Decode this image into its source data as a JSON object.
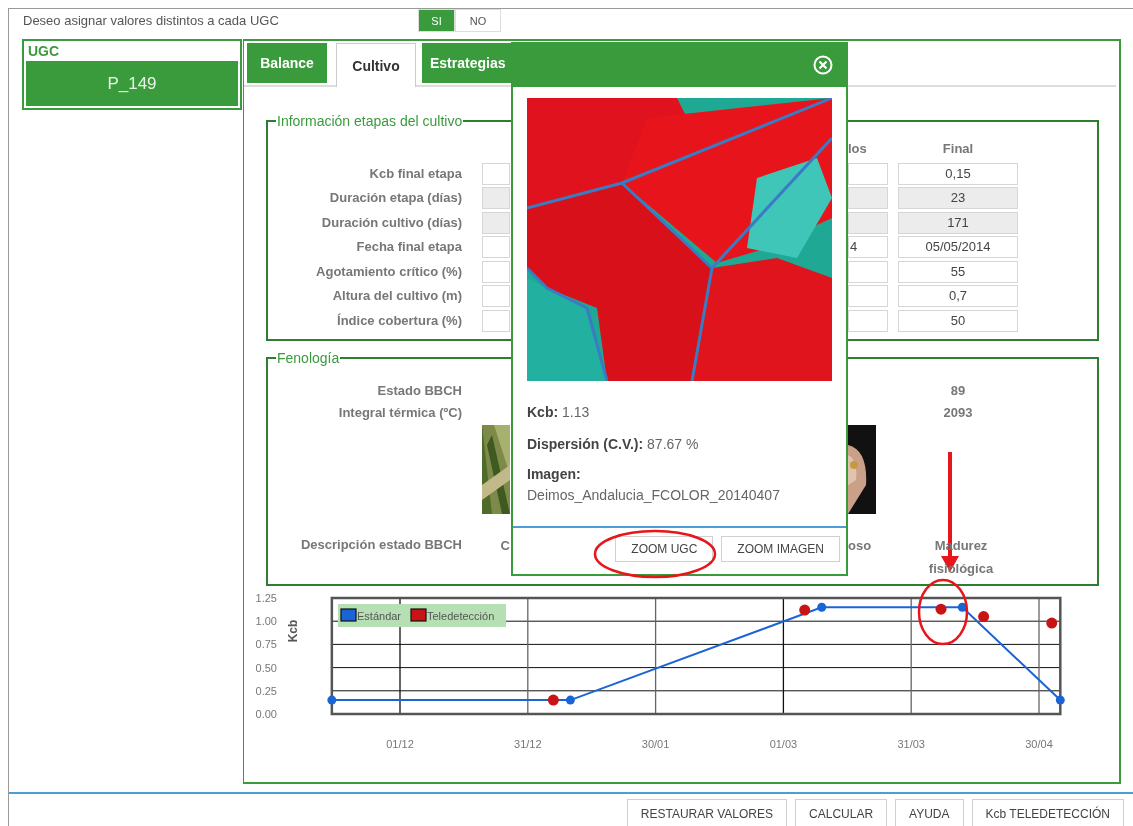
{
  "header": {
    "question": "Deseo asignar valores distintos a cada UGC",
    "toggle": [
      {
        "label": "SI",
        "selected": true
      },
      {
        "label": "NO",
        "selected": false
      }
    ]
  },
  "ugc": {
    "title": "UGC",
    "items": [
      {
        "label": "P_149",
        "selected": true
      }
    ]
  },
  "tabs": [
    {
      "label": "Balance",
      "selected": false
    },
    {
      "label": "Cultivo",
      "selected": true
    },
    {
      "label": "Estrategias",
      "selected": false
    }
  ],
  "stages": {
    "legend": "Información etapas del cultivo",
    "partial_header": "los",
    "final_header": "Final",
    "rows": [
      {
        "label": "Kcb final etapa",
        "readonly": false,
        "final": "0,15"
      },
      {
        "label": "Duración etapa (días)",
        "readonly": true,
        "final": "23"
      },
      {
        "label": "Duración cultivo (días)",
        "readonly": true,
        "final": "171"
      },
      {
        "label": "Fecha final etapa",
        "readonly": false,
        "partial": "4",
        "final": "05/05/2014"
      },
      {
        "label": "Agotamiento crítico (%)",
        "readonly": false,
        "final": "55"
      },
      {
        "label": "Altura del cultivo (m)",
        "readonly": false,
        "final": "0,7"
      },
      {
        "label": "Índice cobertura (%)",
        "readonly": false,
        "final": "50"
      }
    ]
  },
  "phenology": {
    "legend": "Fenología",
    "rows": [
      {
        "label": "Estado BBCH",
        "final": "89"
      },
      {
        "label": "Integral térmica (ºC)",
        "final": "2093"
      }
    ],
    "photos": [
      {
        "kind": "picture"
      },
      {
        "kind": "picture"
      }
    ],
    "description": {
      "label": "Descripción estado BBCH",
      "left_partial": "C",
      "right_partial": "oso",
      "final": "Madurez fisiológica"
    }
  },
  "chart": {
    "chart_data": {
      "type": "line",
      "ylabel": "Kcb",
      "grid": true,
      "legend": "upper left",
      "x": [
        "2013-11-15",
        "2014-01-06",
        "2014-01-10",
        "2014-03-06",
        "2014-03-10",
        "2014-04-07",
        "2014-04-12",
        "2014-04-17",
        "2014-05-03",
        "2014-05-05"
      ],
      "series": [
        {
          "name": "Estándar",
          "type": "line",
          "marker": "circle",
          "color": "#1a64d6",
          "values": [
            0.15,
            null,
            0.15,
            null,
            1.15,
            null,
            1.15,
            null,
            null,
            0.15
          ]
        },
        {
          "name": "Teledetección",
          "type": "scatter",
          "marker": "circle",
          "color": "#c81414",
          "values": [
            null,
            0.15,
            null,
            1.12,
            null,
            1.13,
            null,
            1.05,
            0.98,
            null
          ]
        }
      ],
      "xlim": [
        "2013-11-15",
        "2014-05-05"
      ],
      "ylim": [
        0,
        1.25
      ],
      "xticks": [
        {
          "value": "2013-12-01",
          "label": "01/12"
        },
        {
          "value": "2013-12-31",
          "label": "31/12"
        },
        {
          "value": "2014-01-30",
          "label": "30/01"
        },
        {
          "value": "2014-03-01",
          "label": "01/03"
        },
        {
          "value": "2014-03-31",
          "label": "31/03"
        },
        {
          "value": "2014-04-30",
          "label": "30/04"
        }
      ],
      "yticks": [
        {
          "value": 0,
          "label": "0.00"
        },
        {
          "value": 0.25,
          "label": "0.25"
        },
        {
          "value": 0.5,
          "label": "0.50"
        },
        {
          "value": 0.75,
          "label": "0.75"
        },
        {
          "value": 1,
          "label": "1.00"
        },
        {
          "value": 1.25,
          "label": "1.25"
        }
      ]
    }
  },
  "footer_buttons": [
    "RESTAURAR VALORES",
    "CALCULAR",
    "AYUDA",
    "Kcb TELEDETECCIÓN"
  ],
  "popup": {
    "picture": {
      "kind": "picture"
    },
    "kcb": "**Kcb:** 1.13",
    "dispersion": "**Dispersión (C.V.):** 87.67 %",
    "image_label": "Imagen:",
    "image_name": "Deimos_Andalucia_FCOLOR_20140407",
    "buttons": [
      "ZOOM UGC",
      "ZOOM IMAGEN"
    ]
  },
  "markup": [
    {
      "kind": "ellipse"
    },
    {
      "kind": "ellipse"
    },
    {
      "kind": "arrow"
    }
  ]
}
